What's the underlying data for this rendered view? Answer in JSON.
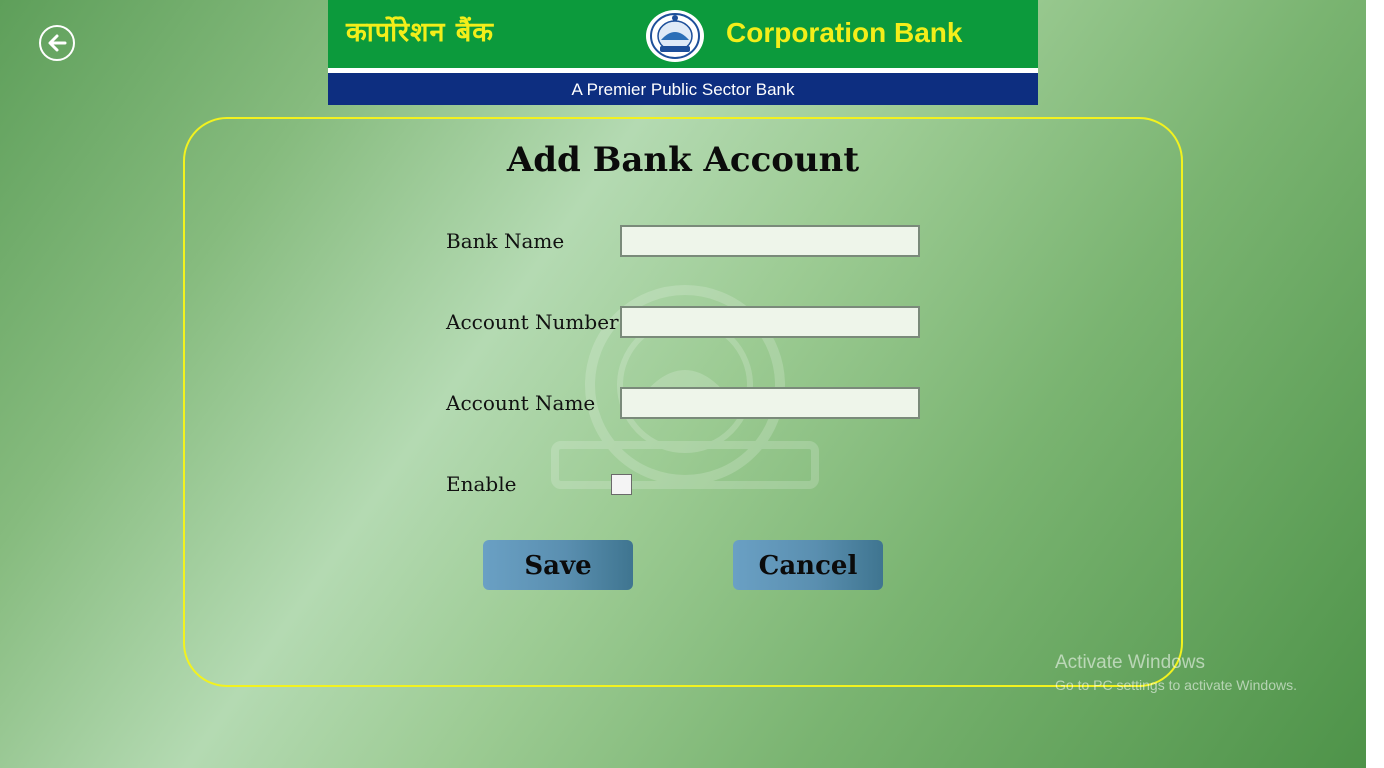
{
  "banner": {
    "hindi_name": "कार्पोरेशन बैंक",
    "english_name": "Corporation Bank",
    "tagline": "A Premier Public Sector Bank"
  },
  "form": {
    "title": "Add Bank Account",
    "bank_name_label": "Bank Name",
    "bank_name_value": "",
    "account_number_label": "Account Number",
    "account_number_value": "",
    "account_name_label": "Account Name",
    "account_name_value": "",
    "enable_label": "Enable",
    "enable_checked": false,
    "save_label": "Save",
    "cancel_label": "Cancel"
  },
  "system": {
    "activate_title": "Activate Windows",
    "activate_sub": "Go to PC settings to activate Windows."
  },
  "colors": {
    "banner_green": "#0c9a3c",
    "banner_blue": "#0d2e80",
    "banner_text_yellow": "#f3ee1a",
    "panel_border": "#f2f21f",
    "button_blue": "#5a8fb0"
  },
  "icons": {
    "back": "back-arrow-icon",
    "logo": "bank-emblem-icon"
  }
}
